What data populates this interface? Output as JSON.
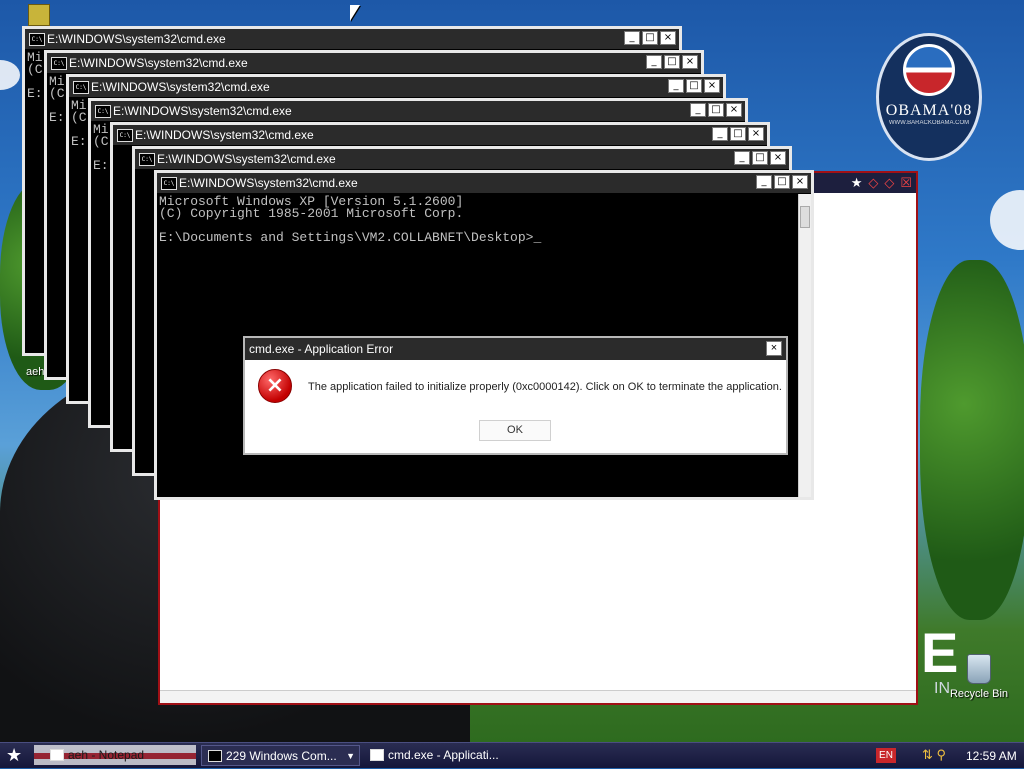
{
  "desktop": {
    "icons": [
      {
        "label": "aeh"
      },
      {
        "label": "Recycle Bin"
      }
    ],
    "logo_text": "OBAMA'08",
    "logo_sub": "WWW.BARACKOBAMA.COM",
    "big_letter": "E",
    "big_in": "IN"
  },
  "cmd_windows": [
    {
      "title": "E:\\WINDOWS\\system32\\cmd.exe",
      "body": "Mi\n(C\n\nE:"
    },
    {
      "title": "E:\\WINDOWS\\system32\\cmd.exe",
      "body": "Mi\n(C\n\nE:"
    },
    {
      "title": "E:\\WINDOWS\\system32\\cmd.exe",
      "body": "Mi\n(C\n\nE:"
    },
    {
      "title": "E:\\WINDOWS\\system32\\cmd.exe",
      "body": "Mi\n(C\n\nE:"
    },
    {
      "title": "E:\\WINDOWS\\system32\\cmd.exe",
      "body": ""
    },
    {
      "title": "E:\\WINDOWS\\system32\\cmd.exe",
      "body": ""
    },
    {
      "title": "E:\\WINDOWS\\system32\\cmd.exe",
      "body": "Microsoft Windows XP [Version 5.1.2600]\n(C) Copyright 1985-2001 Microsoft Corp.\n\nE:\\Documents and Settings\\VM2.COLLABNET\\Desktop>_"
    }
  ],
  "window_controls": {
    "minimize": "_",
    "maximize": "□",
    "close": "×"
  },
  "background_window": {
    "controls": [
      "★",
      "◇",
      "◇",
      "☒"
    ]
  },
  "error_dialog": {
    "title": "cmd.exe - Application Error",
    "message": "The application failed to initialize properly (0xc0000142). Click on OK to terminate the application.",
    "ok_label": "OK",
    "close": "×",
    "icon": "error-icon"
  },
  "taskbar": {
    "start": "★",
    "notepad_label": "aeh - Notepad",
    "cmd_group_label": "229 Windows Com...",
    "error_label": "cmd.exe - Applicati...",
    "language": "EN",
    "clock": "12:59 AM"
  },
  "colors": {
    "titlebar": "#2b2b2b",
    "taskbar": "#14163a",
    "accent_red": "#c8262b"
  }
}
